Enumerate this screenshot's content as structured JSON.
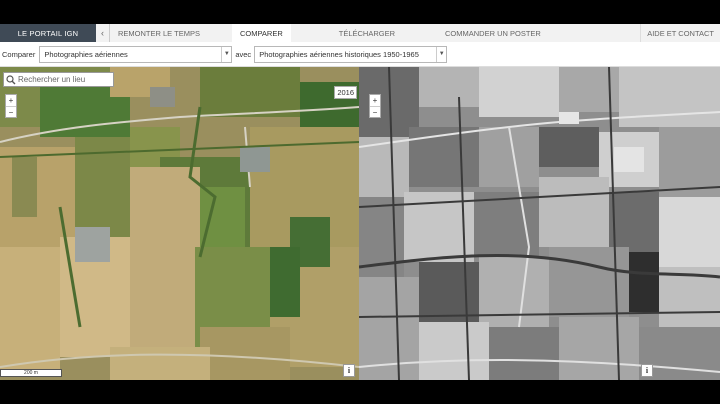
{
  "nav": {
    "portal": "LE PORTAIL IGN",
    "items": [
      "REMONTER LE TEMPS",
      "COMPARER",
      "TÉLÉCHARGER",
      "COMMANDER UN POSTER"
    ],
    "help": "AIDE ET CONTACT"
  },
  "compare": {
    "label": "Comparer",
    "left_select": "Photographies aériennes",
    "avec": "avec",
    "right_select": "Photographies aériennes historiques 1950-1965"
  },
  "left_map": {
    "search_placeholder": "Rechercher un lieu",
    "zoom_in": "+",
    "zoom_out": "−",
    "year": "2016",
    "info": "i",
    "scale": "200 m"
  },
  "right_map": {
    "zoom_in": "+",
    "zoom_out": "−",
    "info": "i"
  },
  "colors": {
    "portal_bg": "#3f4a56",
    "nav_bg": "#f2f2f2"
  }
}
